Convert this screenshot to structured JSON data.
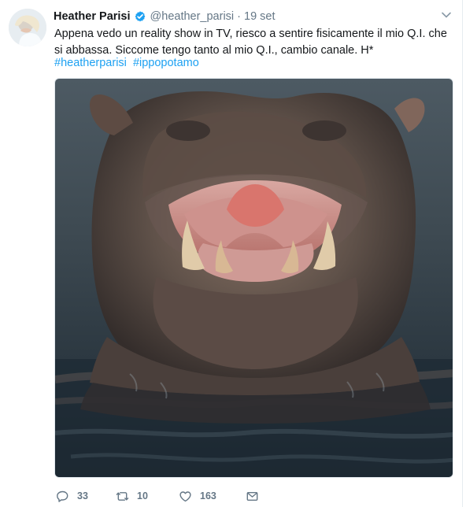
{
  "tweet": {
    "author_name": "Heather Parisi",
    "handle": "@heather_parisi",
    "separator": "·",
    "date": "19 set",
    "text": "Appena vedo un reality show in TV, riesco a sentire fisicamente il mio Q.I. che si abbassa. Siccome tengo tanto al mio Q.I., cambio canale. H*",
    "hashtags": [
      "#heatherparisi",
      "#ippopotamo"
    ],
    "image_subject": "hippopotamus-open-mouth",
    "verified": true
  },
  "actions": {
    "replies": "33",
    "retweets": "10",
    "likes": "163"
  },
  "colors": {
    "accent": "#1da1f2",
    "text": "#14171a",
    "muted": "#657786",
    "border": "#e6ecf0"
  },
  "icons": [
    "verified-badge-icon",
    "chevron-down-icon",
    "reply-icon",
    "retweet-icon",
    "like-icon",
    "direct-message-icon"
  ]
}
